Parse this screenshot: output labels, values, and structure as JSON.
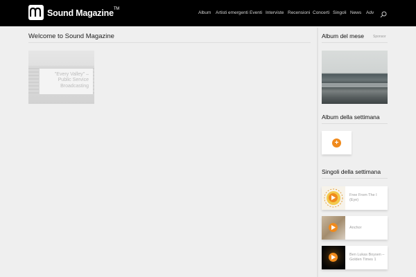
{
  "header": {
    "brand": "Sound Magazine",
    "trademark": "TM",
    "nav": [
      "Album",
      "Artisti emergenti",
      "Eventi",
      "Interviste",
      "Recensioni",
      "Concerti",
      "Singoli",
      "News",
      "Adv"
    ]
  },
  "main": {
    "title": "Welcome to Sound Magazine",
    "post_caption": "\"Every Valley\" – Public Service Broadcasting"
  },
  "sidebar": {
    "album_mese": "Album del mese",
    "sponsor": "Sponsor",
    "album_settimana": "Album della settimana",
    "singoli_settimana": "Singoli della settimana",
    "singoli": [
      {
        "title": "Free From The I (Eye)"
      },
      {
        "title": "Anchor"
      },
      {
        "title": "Ben Lukas Boysen – Golden Times 1"
      }
    ]
  },
  "colors": {
    "accent": "#f08a1c",
    "topbar": "#000000",
    "background": "#efefef"
  },
  "icons": {
    "search": "search-icon",
    "play": "play-icon",
    "add": "plus-icon",
    "logo": "sound-magazine-logo"
  }
}
